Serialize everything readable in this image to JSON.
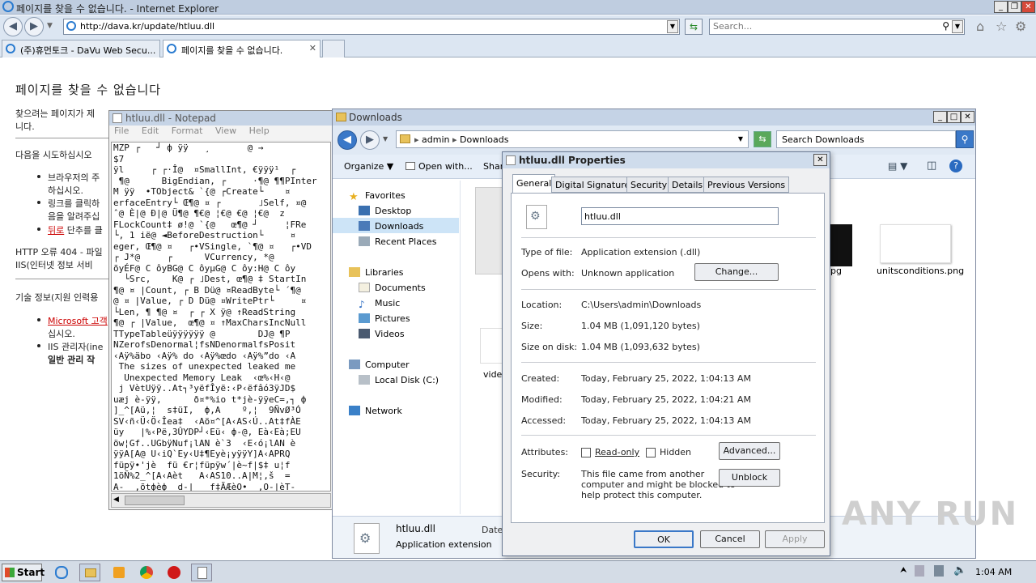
{
  "ie": {
    "title": "페이지를 찾을 수 없습니다. - Internet Explorer",
    "address": "http://dava.kr/update/htluu.dll",
    "search_placeholder": "Search...",
    "tabs": [
      {
        "label": "(주)휴먼토크 - DaVu Web Secu..."
      },
      {
        "label": "페이지를 찾을 수 없습니다."
      }
    ]
  },
  "page": {
    "heading": "페이지를 찾을 수 없습니다",
    "p1a": "찾으려는 페이지가 제",
    "p1b": "니다.",
    "try_heading": "다음을 시도하십시오",
    "b1a": "브라우저의 주",
    "b1b": "하십시오.",
    "b2a": "링크를 클릭하",
    "b2b": "음을 알려주십",
    "b3_link": "뒤로",
    "b3_rest": " 단추를 클",
    "http_error_a": "HTTP 오류 404 - 파일",
    "http_error_b": "IIS(인터넷 정보 서비",
    "tech_info": "기술 정보(지원 인력용",
    "t1_link": "Microsoft 고객",
    "t1b": "십시오.",
    "t2a": "IIS 관리자(ine",
    "t2b": "일반 관리 작"
  },
  "notepad": {
    "title": "htluu.dll - Notepad",
    "menu": [
      "File",
      "Edit",
      "Format",
      "View",
      "Help"
    ],
    "lines": [
      "MZP ┌   ┘ ф ÿÿ   ¸       @ →",
      "$7",
      "ÿl     ┌ ┌·Î@  ¤SmallInt, €ÿÿÿ¹  ┌",
      " ¶@      BigEndian, ┌     ·¶@ ¶¶PInter",
      "M ÿÿ  •TObject& `{@ ┌Create└    ¤",
      "erfaceEntry└ Œ¶@ ¤ ┌       ˩Self, ¤@",
      "ˆ@ È|@ Ð|@ Ü¶@ ¶€@ ¦€@ €@ ¦€@  z",
      "FLockCount‡ ø!@ `{@   œ¶@ ┘     ¦FRe",
      "└, 1 ië@ ◄BeforeDestruction└     ¤",
      "eger, Œ¶@ ¤   ┌•VSingle, `¶@ ¤   ┌•VD",
      "┌ J*@     ┌      VCurrency, *@",
      "õyÉF@ C ôyBG@ C ôyµG@ C ôy:H@ C ôy",
      "  └Src,    K@ ┌ ˩Dest, œ¶@ ‡ StartIn",
      "¶@ ¤ |Count, ┌ B Dü@ ¤ReadByte└ ´¶@",
      "@ ¤ |Value, ┌ D Dü@ ¤WritePtr└     ¤",
      "└Len, ¶ ¶@ ¤  ┌ ┌ X ÿ@ ↑ReadString",
      "¶@ ┌ |Value,  œ¶@ ¤ ↑MaxCharsIncNull",
      "TTypeTableüÿÿÿÿÿÿ @        DJ@ ¶P",
      "NZerofsDenormal¦fsNDenormalfsPosit",
      "‹Aÿ%äbo ‹Aÿ% do ‹Aÿ%œdo ‹Aÿ%”do ‹A",
      " The sizes of unexpected leaked me",
      "  Unexpected Memory Leak  ‹œ%‹H‹@",
      " j VètUÿÿ..At┐³yëfÎyë:‹P‹ëfâó3ÿJD$",
      "uæj è-ÿÿ,      ð¤*%io t*jè-ÿÿeC=,┐ ф",
      "]_^[Aü,¦  s‡üI,  ф,A    º,¦  9ÑvØ³Ó",
      "SV‹ñ‹Ü‹Ö‹Îea‡  ‹Aö¤^[A‹AS‹Ú..At‡fÀE",
      "üy   |%‹Pë,3ÛYDP┘‹Eü‹ ф-@, Eà‹Eà;EU",
      "öw¦Gf..UGbÿNuf¡lAN è`3  ‹E‹ó¡lAN è",
      "ÿÿA[A@ U‹iQ`Ey‹U‡¶Eyè¡yÿÿY]A‹APRQ",
      "füpÿ•'jè  fü €r¦füpÿw´|è~f|$‡ u¦f",
      "1öÑ%2_^[A‹Aèt   A‹AS10..A|M¦,š  =",
      "A-  ,õtфèф  d-|   f‡ÃÆèO•  ,O-|èT-",
      "A..ÿtф-фQfC,òf t‡Y‹RÐ..Ðuã1A_ÄX A)E‹D"
    ]
  },
  "explorer": {
    "title": "Downloads",
    "breadcrumb": [
      "admin",
      "Downloads"
    ],
    "search_placeholder": "Search Downloads",
    "toolbar": {
      "organize": "Organize",
      "open_with": "Open with...",
      "share": "Shar"
    },
    "nav": {
      "favorites": "Favorites",
      "desktop": "Desktop",
      "downloads": "Downloads",
      "recent": "Recent Places",
      "libraries": "Libraries",
      "documents": "Documents",
      "music": "Music",
      "pictures": "Pictures",
      "videos": "Videos",
      "computer": "Computer",
      "local_disk": "Local Disk (C:)",
      "network": "Network"
    },
    "files": [
      {
        "label": "jpg"
      },
      {
        "label": "unitsconditions.png"
      },
      {
        "label": "vide"
      }
    ],
    "details": {
      "name": "htluu.dll",
      "type": "Application extension",
      "date_label": "Date"
    }
  },
  "properties": {
    "title": "htluu.dll Properties",
    "tabs": [
      "General",
      "Digital Signatures",
      "Security",
      "Details",
      "Previous Versions"
    ],
    "file_name": "htluu.dll",
    "rows": {
      "type_label": "Type of file:",
      "type_value": "Application extension (.dll)",
      "opens_label": "Opens with:",
      "opens_value": "Unknown application",
      "location_label": "Location:",
      "location_value": "C:\\Users\\admin\\Downloads",
      "size_label": "Size:",
      "size_value": "1.04 MB (1,091,120 bytes)",
      "size_disk_label": "Size on disk:",
      "size_disk_value": "1.04 MB (1,093,632 bytes)",
      "created_label": "Created:",
      "created_value": "Today, February 25, 2022, 1:04:13 AM",
      "modified_label": "Modified:",
      "modified_value": "Today, February 25, 2022, 1:04:21 AM",
      "accessed_label": "Accessed:",
      "accessed_value": "Today, February 25, 2022, 1:04:13 AM",
      "attributes_label": "Attributes:",
      "readonly_label": "Read-only",
      "hidden_label": "Hidden",
      "security_label": "Security:",
      "security_text_1": "This file came from another",
      "security_text_2": "computer and might be blocked to",
      "security_text_3": "help protect this computer."
    },
    "buttons": {
      "change": "Change...",
      "advanced": "Advanced...",
      "unblock": "Unblock",
      "ok": "OK",
      "cancel": "Cancel",
      "apply": "Apply"
    }
  },
  "taskbar": {
    "start": "Start",
    "clock": "1:04 AM"
  },
  "watermark": "ANY RUN"
}
